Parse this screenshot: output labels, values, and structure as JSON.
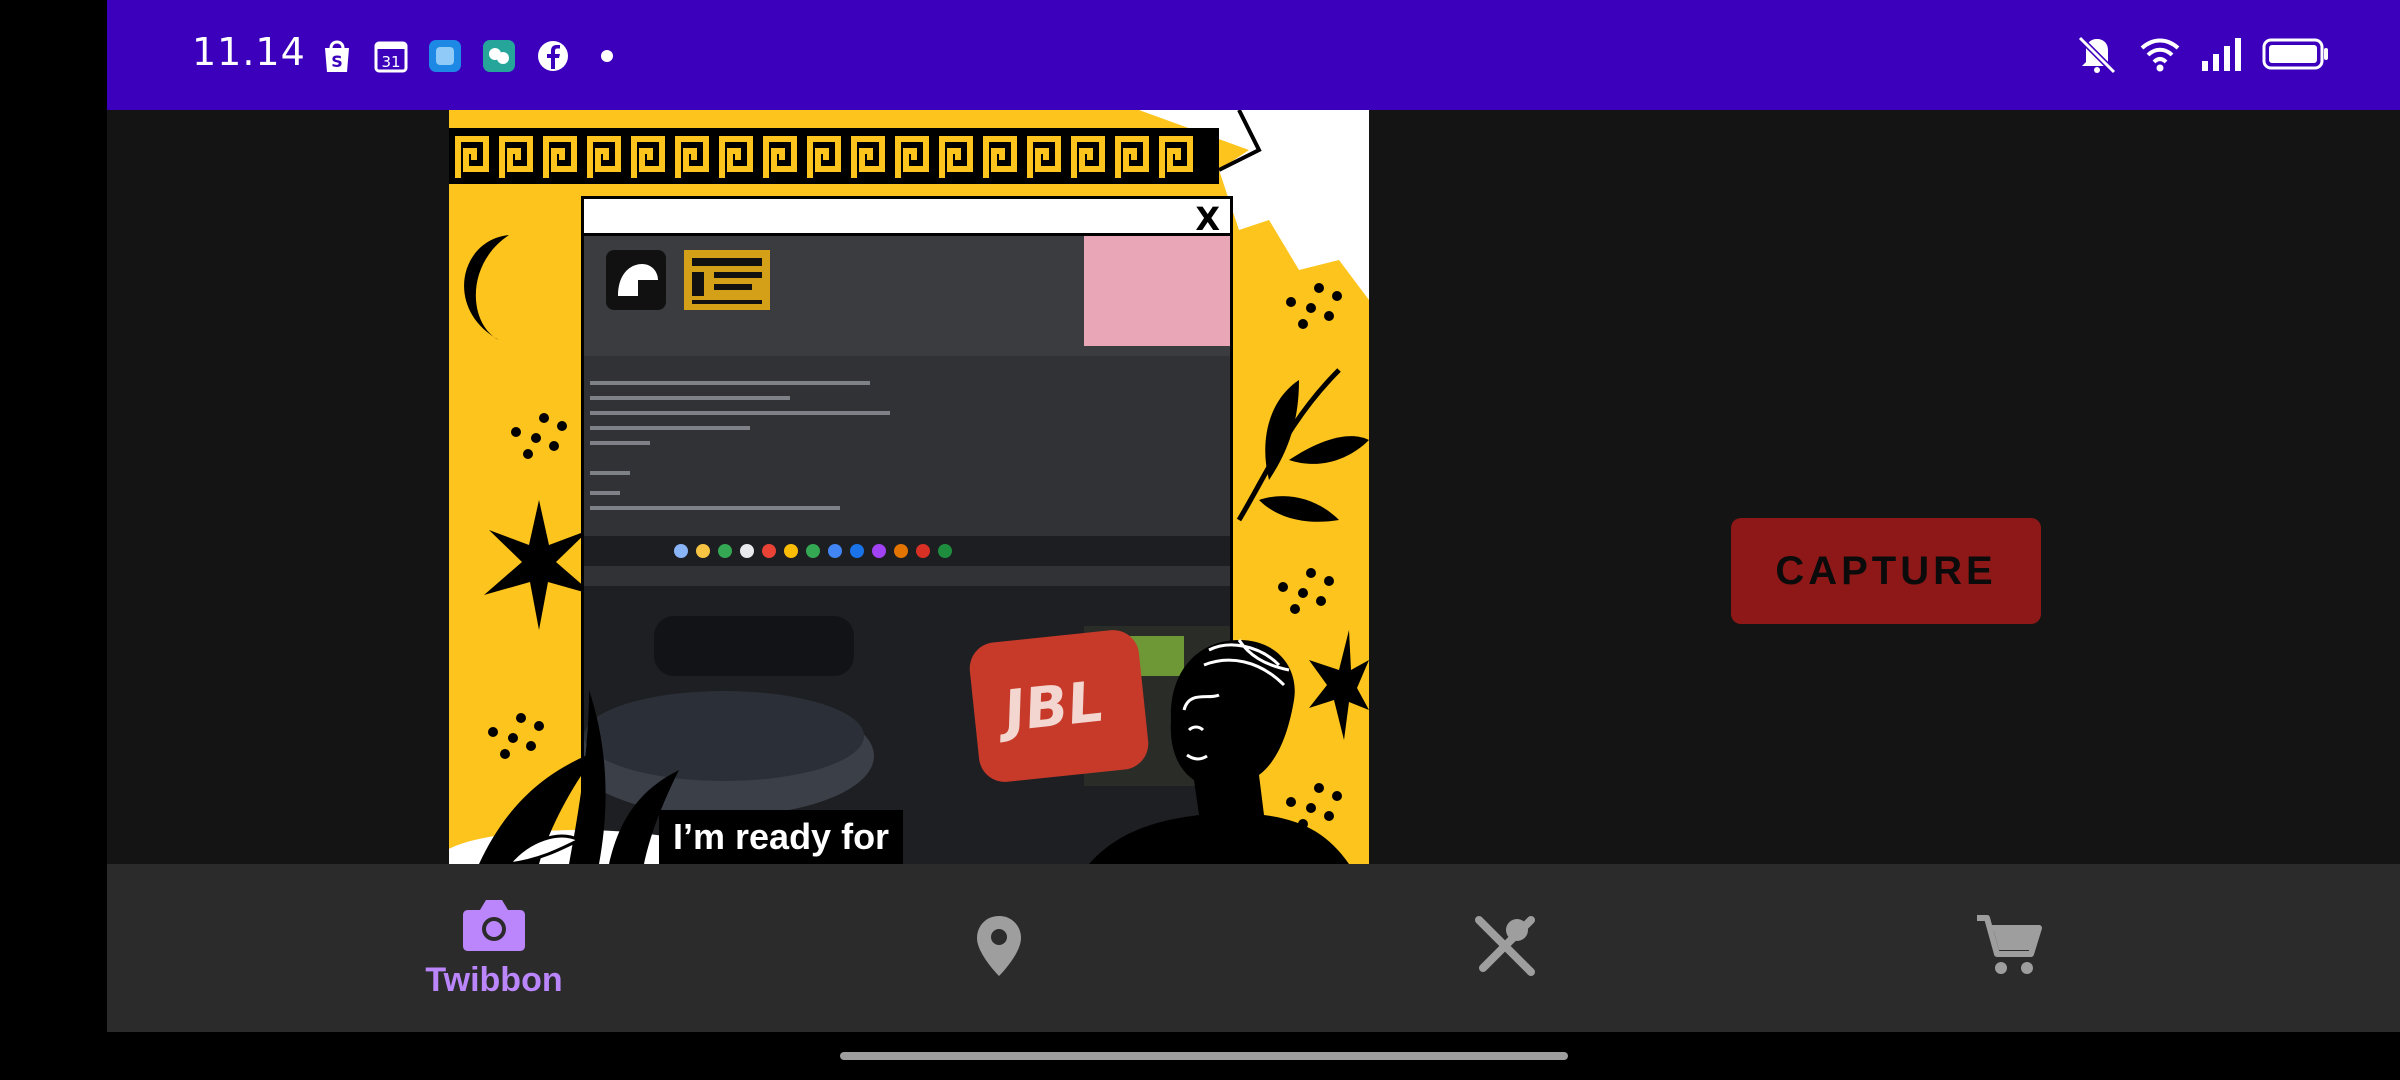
{
  "status_bar": {
    "time": "11.14",
    "notification_icons": [
      "shopee-icon",
      "calendar-icon",
      "app-icon",
      "wechat-icon",
      "facebook-icon",
      "more-dot-icon"
    ],
    "calendar_day": "31",
    "system_icons": [
      "mute-icon",
      "wifi-icon",
      "signal-icon",
      "battery-icon"
    ],
    "color": "#3c00bd"
  },
  "twibbon": {
    "close_label": "X",
    "caption": "I’m ready for",
    "speaker_brand": "JBL",
    "frame_color": "#fcc41c"
  },
  "capture_button": {
    "label": "CAPTURE",
    "color": "#8e1817"
  },
  "bottom_nav": {
    "items": [
      {
        "label": "Twibbon",
        "icon": "camera-icon",
        "active": true
      },
      {
        "label": "",
        "icon": "location-pin-icon",
        "active": false
      },
      {
        "label": "",
        "icon": "restaurant-icon",
        "active": false
      },
      {
        "label": "",
        "icon": "cart-icon",
        "active": false
      }
    ],
    "active_color": "#bb86fc",
    "inactive_color": "#9e9e9e"
  }
}
